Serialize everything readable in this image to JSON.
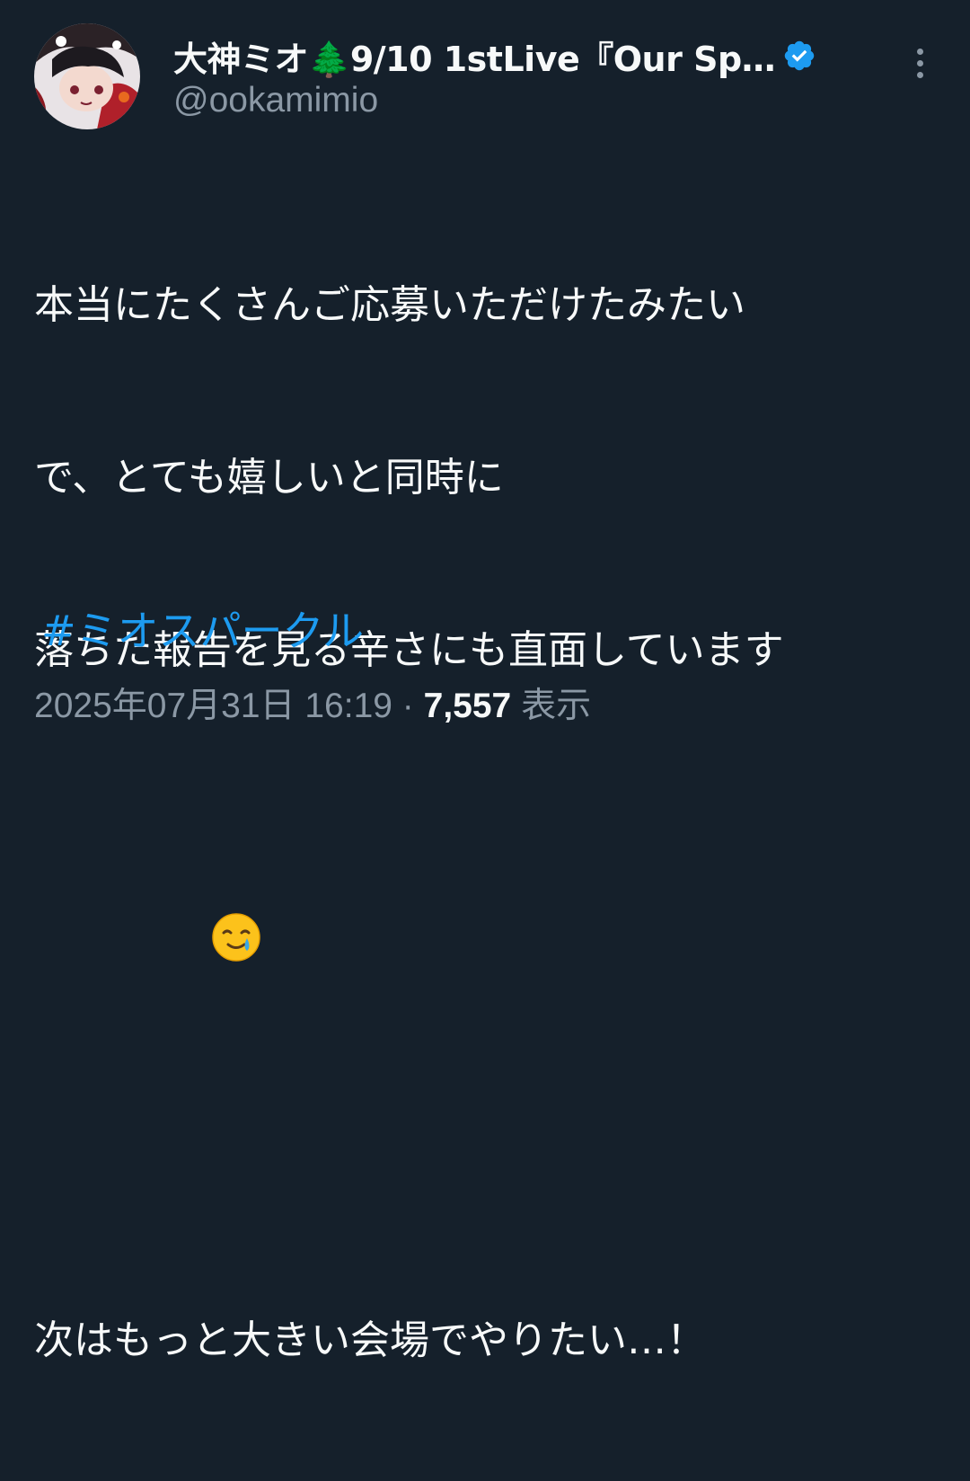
{
  "tweet": {
    "display_name": "大神ミオ🌲9/10 1stLive『Our Sp…",
    "handle": "@ookamimio",
    "verified_icon": "verified-badge-icon",
    "body_lines": [
      "本当にたくさんご応募いただけたみたい",
      "で、とても嬉しいと同時に",
      "落ちた報告を見る辛さにも直面しています",
      "",
      "",
      "",
      "次はもっと大きい会場でやりたい…！"
    ],
    "emoji": "🥲",
    "hashtag": "#ミオスパークル",
    "timestamp": "2025年07月31日 16:19",
    "separator": " · ",
    "views_count": "7,557",
    "views_label": " 表示"
  },
  "colors": {
    "background": "#15202b",
    "text": "#f7f9f9",
    "muted": "#8b98a5",
    "link": "#1d9bf0",
    "verified": "#1d9bf0"
  }
}
